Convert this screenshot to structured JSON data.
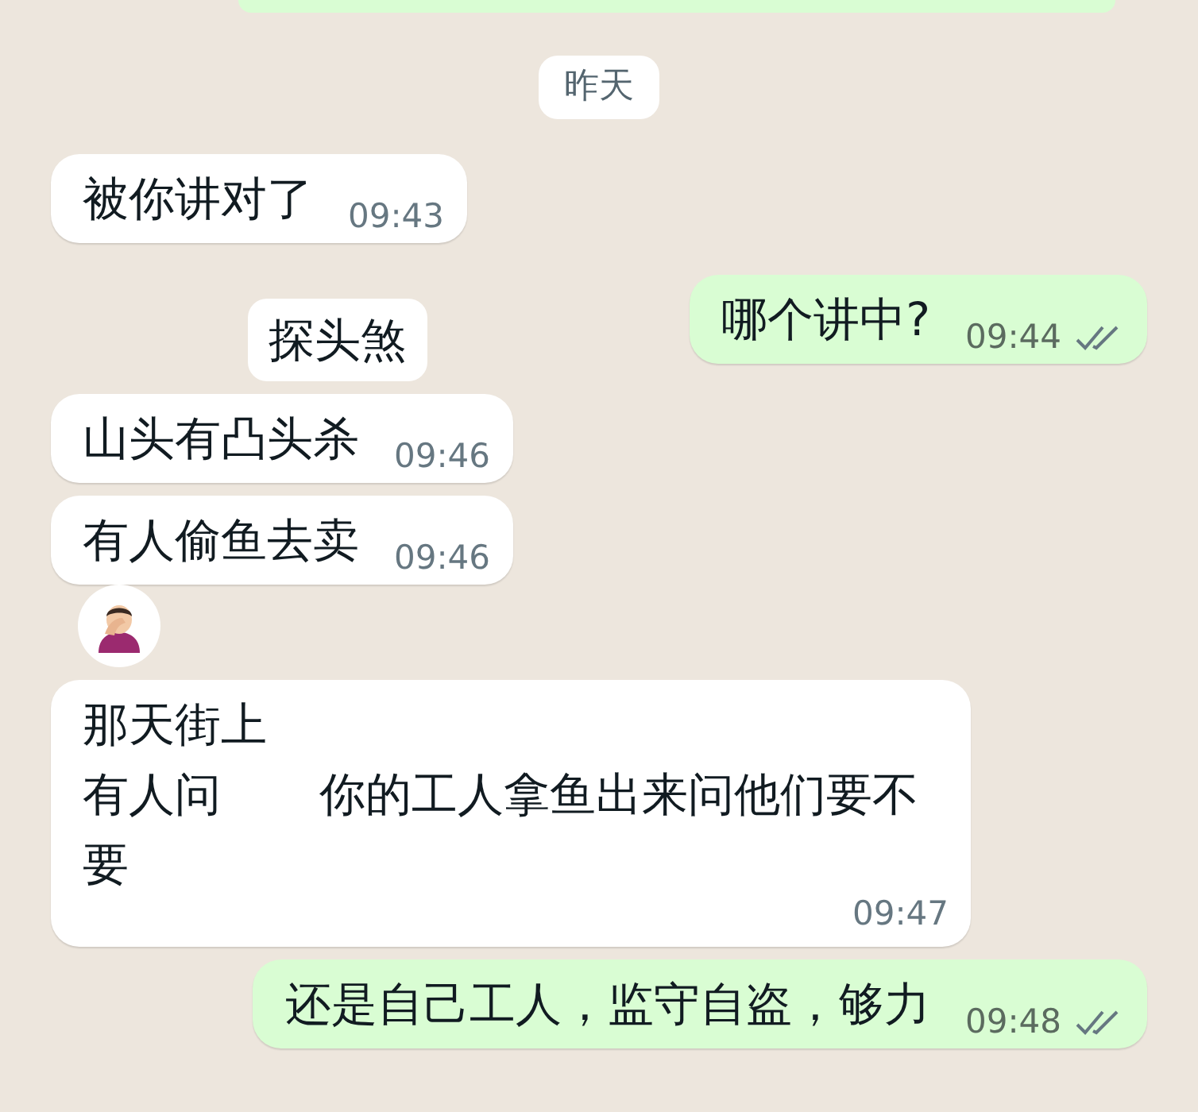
{
  "date_divider": "昨天",
  "messages": [
    {
      "kind": "text",
      "outgoing": false,
      "lines": [
        [
          "被你讲对了"
        ]
      ],
      "time": "09:43"
    },
    {
      "kind": "snippet",
      "outgoing": false,
      "lines": [
        [
          "探头煞"
        ]
      ]
    },
    {
      "kind": "text",
      "outgoing": true,
      "lines": [
        [
          "哪个讲中?"
        ]
      ],
      "time": "09:44",
      "read": false
    },
    {
      "kind": "text",
      "outgoing": false,
      "lines": [
        [
          "山头有凸头杀"
        ]
      ],
      "time": "09:46"
    },
    {
      "kind": "text",
      "outgoing": false,
      "lines": [
        [
          "有人偷鱼去卖"
        ]
      ],
      "time": "09:46"
    },
    {
      "kind": "emoji",
      "outgoing": false
    },
    {
      "kind": "text",
      "outgoing": false,
      "lines": [
        [
          "那天街上"
        ],
        [
          "有人问",
          "你的工人拿鱼出来问他们要不要"
        ]
      ],
      "time": "09:47"
    },
    {
      "kind": "text",
      "outgoing": true,
      "lines": [
        [
          "还是自己工人，监守自盗，够力"
        ]
      ],
      "time": "09:48",
      "read": false
    }
  ]
}
